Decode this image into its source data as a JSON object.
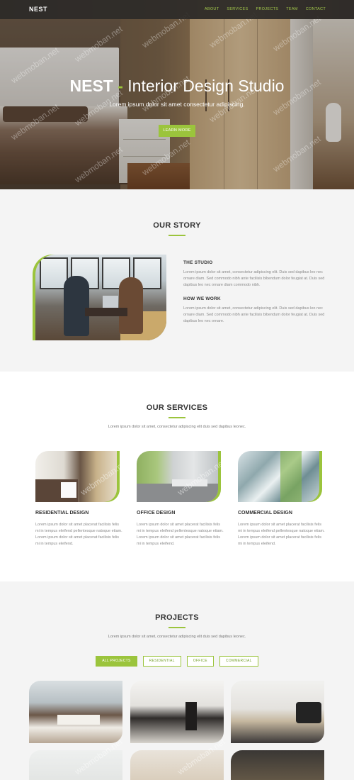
{
  "nav": {
    "brand": "NEST",
    "items": [
      "ABOUT",
      "SERVICES",
      "PROJECTS",
      "TEAM",
      "CONTACT"
    ]
  },
  "hero": {
    "title_strong": "NEST",
    "title_dash": " - ",
    "title_rest": "Interior Design Studio",
    "subtitle": "Lorem ipsum dolor sit amet consectetur adipiscing.",
    "button": "LEARN MORE"
  },
  "watermark": "webmoban.net",
  "story": {
    "title": "OUR STORY",
    "blocks": [
      {
        "heading": "THE STUDIO",
        "text": "Lorem ipsum dolor sit amet, consectetur adipiscing elit. Duis sed dapibus leo nec ornare diam. Sed commodo nibh ante facilisis bibendum dolor feugiat at. Duis sed dapibus leo nec ornare diam commodo nibh."
      },
      {
        "heading": "HOW WE WORK",
        "text": "Lorem ipsum dolor sit amet, consectetur adipiscing elit. Duis sed dapibus leo nec ornare diam. Sed commodo nibh ante facilisis bibendum dolor feugiat at. Duis sed dapibus leo nec ornare."
      }
    ]
  },
  "services": {
    "title": "OUR SERVICES",
    "description": "Lorem ipsum dolor sit amet, consectetur adipiscing elit duis sed dapibus leonec.",
    "items": [
      {
        "heading": "RESIDENTIAL DESIGN",
        "text": "Lorem ipsum dolor sit amet placerat facilisis felis mi in tempus eleifend pellentesque natoque etiam. Lorem ipsum dolor sit amet placerat facilisis felis mi in tempus eleifend."
      },
      {
        "heading": "OFFICE DESIGN",
        "text": "Lorem ipsum dolor sit amet placerat facilisis felis mi in tempus eleifend pellentesque natoque etiam. Lorem ipsum dolor sit amet placerat facilisis felis mi in tempus eleifend."
      },
      {
        "heading": "COMMERCIAL DESIGN",
        "text": "Lorem ipsum dolor sit amet placerat facilisis felis mi in tempus eleifend pellentesque natoque etiam. Lorem ipsum dolor sit amet placerat facilisis felis mi in tempus eleifend."
      }
    ]
  },
  "projects": {
    "title": "PROJECTS",
    "description": "Lorem ipsum dolor sit amet, consectetur adipiscing elit duis sed dapibus leonec.",
    "filters": [
      "ALL PROJECTS",
      "RESIDENTIAL",
      "OFFICE",
      "COMMERCIAL"
    ],
    "active_filter": "ALL PROJECTS"
  },
  "colors": {
    "accent": "#9bc43c",
    "nav_bg": "#2d2a28",
    "section_alt_bg": "#f4f4f4",
    "section_bg": "#ffffff"
  }
}
